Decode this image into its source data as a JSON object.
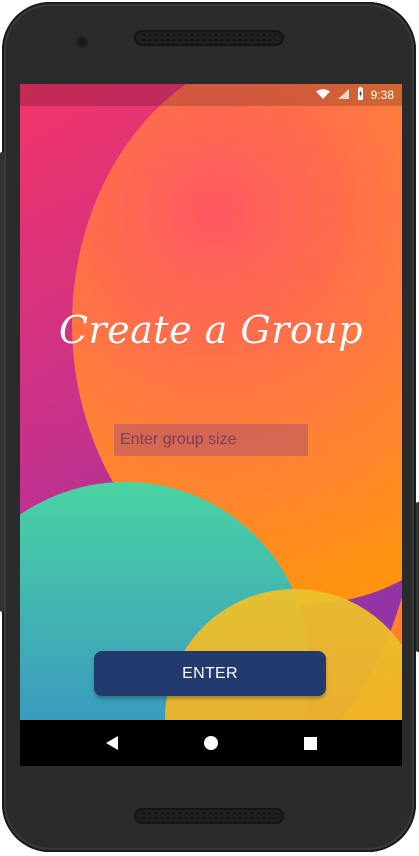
{
  "status_bar": {
    "time": "9:38",
    "icons": [
      "wifi-icon",
      "signal-icon",
      "battery-charging-icon"
    ]
  },
  "app": {
    "title": "Create a Group",
    "input": {
      "placeholder": "Enter group size",
      "value": ""
    },
    "button": {
      "label": "ENTER"
    }
  },
  "navigation": {
    "back": "back-icon",
    "home": "home-icon",
    "recents": "recents-icon"
  },
  "colors": {
    "button": "#233a6f",
    "status_bar": "#ffffff"
  }
}
